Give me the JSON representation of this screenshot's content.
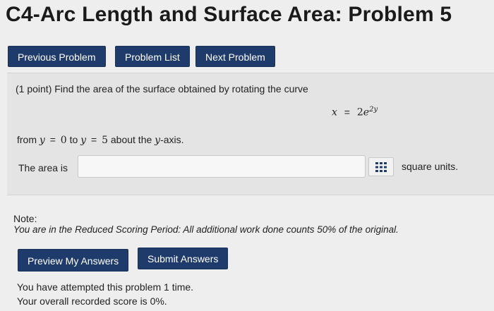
{
  "header": {
    "title": "C4-Arc Length and Surface Area: Problem 5"
  },
  "nav": {
    "previous": "Previous Problem",
    "list": "Problem List",
    "next": "Next Problem"
  },
  "problem": {
    "prompt": "(1 point) Find the area of the surface obtained by rotating the curve",
    "equation": {
      "lhs": "x",
      "eq": "=",
      "coef": "2",
      "base": "e",
      "exponent": "2y"
    },
    "from_text": {
      "from": "from",
      "y1": "y",
      "eq1": "=",
      "v1": "0",
      "to": "to",
      "y2": "y",
      "eq2": "=",
      "v2": "5",
      "about": "about the",
      "axis_var": "y",
      "axis_suffix": "-axis."
    },
    "answer_label": "The area is",
    "answer_value": "",
    "units": "square units."
  },
  "note": {
    "title": "Note:",
    "text": "You are in the Reduced Scoring Period: All additional work done counts 50% of the original."
  },
  "actions": {
    "preview": "Preview My Answers",
    "submit": "Submit Answers"
  },
  "status": {
    "attempts": "You have attempted this problem 1 time.",
    "score": "Your overall recorded score is 0%."
  },
  "colors": {
    "button_bg": "#1f3b6b",
    "page_bg": "#eeeeee",
    "panel_bg": "#e4e4e4"
  },
  "icons": {
    "matrix": "matrix-grid-icon"
  }
}
